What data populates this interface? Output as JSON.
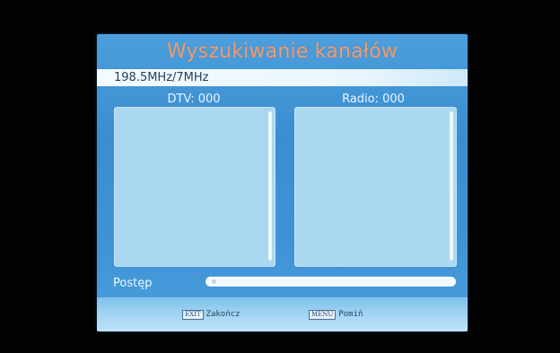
{
  "screen": {
    "title": "Wyszukiwanie kanałów",
    "frequency": "198.5MHz/7MHz"
  },
  "columns": {
    "dtv_label": "DTV: 000",
    "radio_label": "Radio: 000",
    "dtv_channels": [],
    "radio_channels": []
  },
  "progress": {
    "label": "Postęp",
    "percent": 0
  },
  "footer": {
    "exit_key": "EXIT",
    "exit_label": "Zakończ",
    "menu_key": "MENU",
    "menu_label": "Pomiń"
  },
  "colors": {
    "title": "#f19a6e",
    "panel_bg": "#3f93d5",
    "list_bg": "#aad8f1"
  }
}
